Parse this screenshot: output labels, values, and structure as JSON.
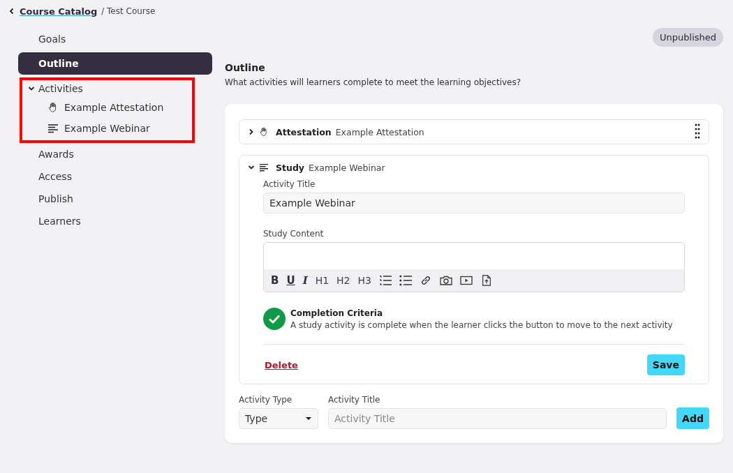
{
  "breadcrumb": {
    "link": "Course Catalog",
    "current": "/ Test Course"
  },
  "status_badge": "Unpublished",
  "sidebar": {
    "items": [
      {
        "label": "Goals",
        "selected": false
      },
      {
        "label": "Outline",
        "selected": true
      },
      {
        "label": "Activities",
        "selected": false,
        "expanded": true,
        "highlighted": true,
        "children": [
          {
            "label": "Example Attestation",
            "kind": "attestation"
          },
          {
            "label": "Example Webinar",
            "kind": "study"
          }
        ]
      },
      {
        "label": "Awards",
        "selected": false
      },
      {
        "label": "Access",
        "selected": false
      },
      {
        "label": "Publish",
        "selected": false
      },
      {
        "label": "Learners",
        "selected": false
      }
    ]
  },
  "section": {
    "title": "Outline",
    "description": "What activities will learners complete to meet the learning objectives?"
  },
  "activities": [
    {
      "kind": "attestation",
      "type_label": "Attestation",
      "title": "Example Attestation",
      "expanded": false
    },
    {
      "kind": "study",
      "type_label": "Study",
      "title": "Example Webinar",
      "expanded": true,
      "form": {
        "title_label": "Activity Title",
        "title_value": "Example Webinar",
        "content_label": "Study Content",
        "toolbar": [
          {
            "kind": "bold",
            "label": "B"
          },
          {
            "kind": "underline",
            "label": "U"
          },
          {
            "kind": "italic",
            "label": "I"
          },
          {
            "kind": "heading",
            "label": "H1"
          },
          {
            "kind": "heading",
            "label": "H2"
          },
          {
            "kind": "heading",
            "label": "H3"
          },
          {
            "kind": "ordered-list"
          },
          {
            "kind": "bullet-list"
          },
          {
            "kind": "link"
          },
          {
            "kind": "camera"
          },
          {
            "kind": "video"
          },
          {
            "kind": "upload"
          }
        ],
        "criteria_title": "Completion Criteria",
        "criteria_text": "A study activity is complete when the learner clicks the button to move to the next activity",
        "delete": "Delete",
        "save": "Save"
      }
    }
  ],
  "new_activity": {
    "type_label": "Activity Type",
    "type_value": "Type",
    "title_label": "Activity Title",
    "title_placeholder": "Activity Title",
    "add": "Add"
  }
}
